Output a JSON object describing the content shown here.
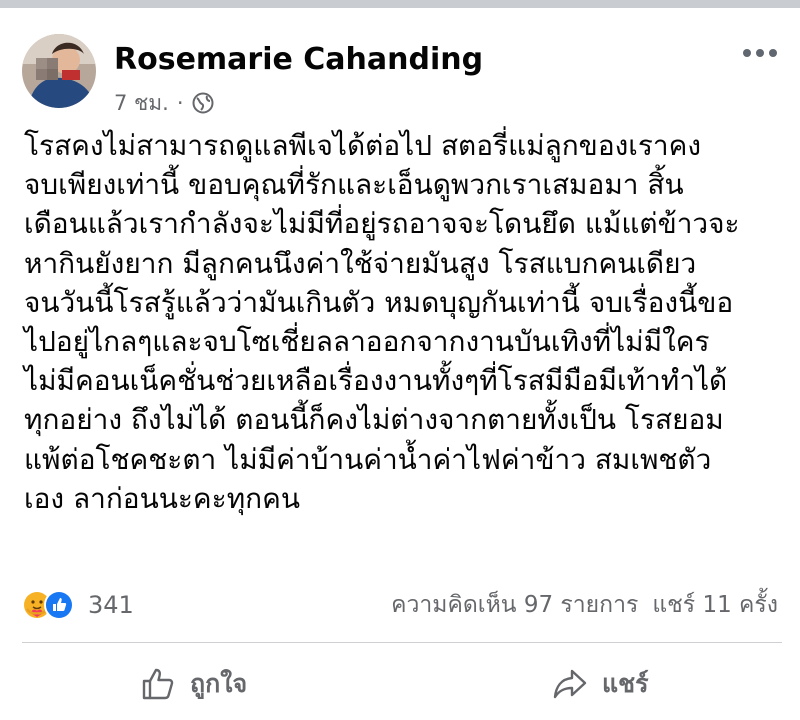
{
  "post": {
    "author": "Rosemarie Cahanding",
    "time": "7 ชม.",
    "privacy_icon": "globe-icon",
    "text": "โรสคงไม่สามารถดูแลพีเจได้ต่อไป สตอรี่แม่ลูกของเราคง\nจบเพียงเท่านี้ ขอบคุณที่รักและเอ็นดูพวกเราเสมอมา สิ้น\nเดือนแล้วเรากำลังจะไม่มีที่อยู่รถอาจจะโดนยึด แม้แต่ข้าวจะ\nหากินยังยาก มีลูกคนนึงค่าใช้จ่ายมันสูง โรสแบกคนเดียว\nจนวันนี้โรสรู้แล้วว่ามันเกินตัว หมดบุญกันเท่านี้ จบเรื่องนี้ขอ\nไปอยู่ไกลๆและจบโซเชี่ยลลาออกจากงานบันเทิงที่ไม่มีใคร\nไม่มีคอนเน็คชั่นช่วยเหลือเรื่องงานทั้งๆที่โรสมีมือมีเท้าทำได้\nทุกอย่าง ถึงไม่ได้ ตอนนี้ก็คงไม่ต่างจากตายทั้งเป็น โรสยอม\nแพ้ต่อโชคชะตา ไม่มีค่าบ้านค่าน้ำค่าไฟค่าข้าว สมเพชตัว\nเอง ลาก่อนนะคะทุกคน"
  },
  "reactions": {
    "icons": [
      "care-reaction-icon",
      "like-reaction-icon"
    ],
    "count": "341"
  },
  "stats": {
    "comments": "ความคิดเห็น 97 รายการ",
    "shares": "แชร์ 11 ครั้ง"
  },
  "actions": {
    "like_label": "ถูกใจ",
    "share_label": "แชร์"
  },
  "colors": {
    "text": "#050505",
    "secondary": "#65676b",
    "like_blue": "#1877f2",
    "care_yellow": "#f7b125",
    "care_red": "#f33e58",
    "divider": "#ced0d4"
  }
}
